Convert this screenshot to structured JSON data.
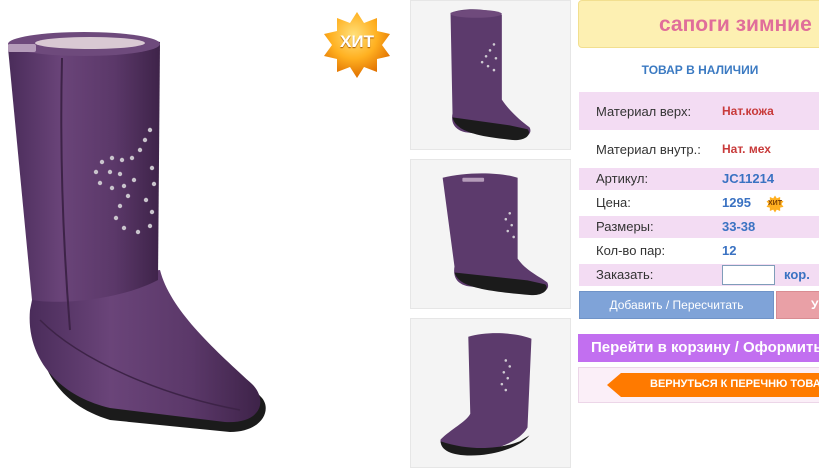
{
  "product": {
    "badge": "ХИТ",
    "title": "сапоги зимние",
    "stock_status": "ТОВАР В НАЛИЧИИ"
  },
  "specs": {
    "material_top_label": "Материал верх:",
    "material_top_value": "Нат.кожа",
    "material_inner_label": "Материал внутр.:",
    "material_inner_value": "Нат. мех",
    "article_label": "Артикул:",
    "article_value": "JC11214",
    "price_label": "Цена:",
    "price_value": "1295",
    "price_badge": "ХИТ",
    "sizes_label": "Размеры:",
    "sizes_value": "33-38",
    "pairs_label": "Кол-во пар:",
    "pairs_value": "12",
    "order_label": "Заказать:",
    "order_input_value": "",
    "order_unit": "кор."
  },
  "actions": {
    "recalc_label": "Добавить / Пересчитать",
    "second_label": "У",
    "cart_label": "Перейти в корзину / Оформить",
    "back_label": "ВЕРНУТЬСЯ К ПЕРЕЧНЮ ТОВАРОВ"
  },
  "icons": {
    "badge": "star-burst-badge-icon",
    "back": "arrow-left-icon"
  },
  "colors": {
    "boot_purple": "#5e3a6e",
    "boot_purple_dark": "#3f2450",
    "sole": "#1a1a1a",
    "title_bg": "#fdf0b2",
    "title_text": "#e06e9a",
    "accent_blue": "#3a72c2",
    "cart_purple": "#c26ff0",
    "back_orange": "#ff7a00",
    "spec_pink": "#f3dcf3"
  }
}
